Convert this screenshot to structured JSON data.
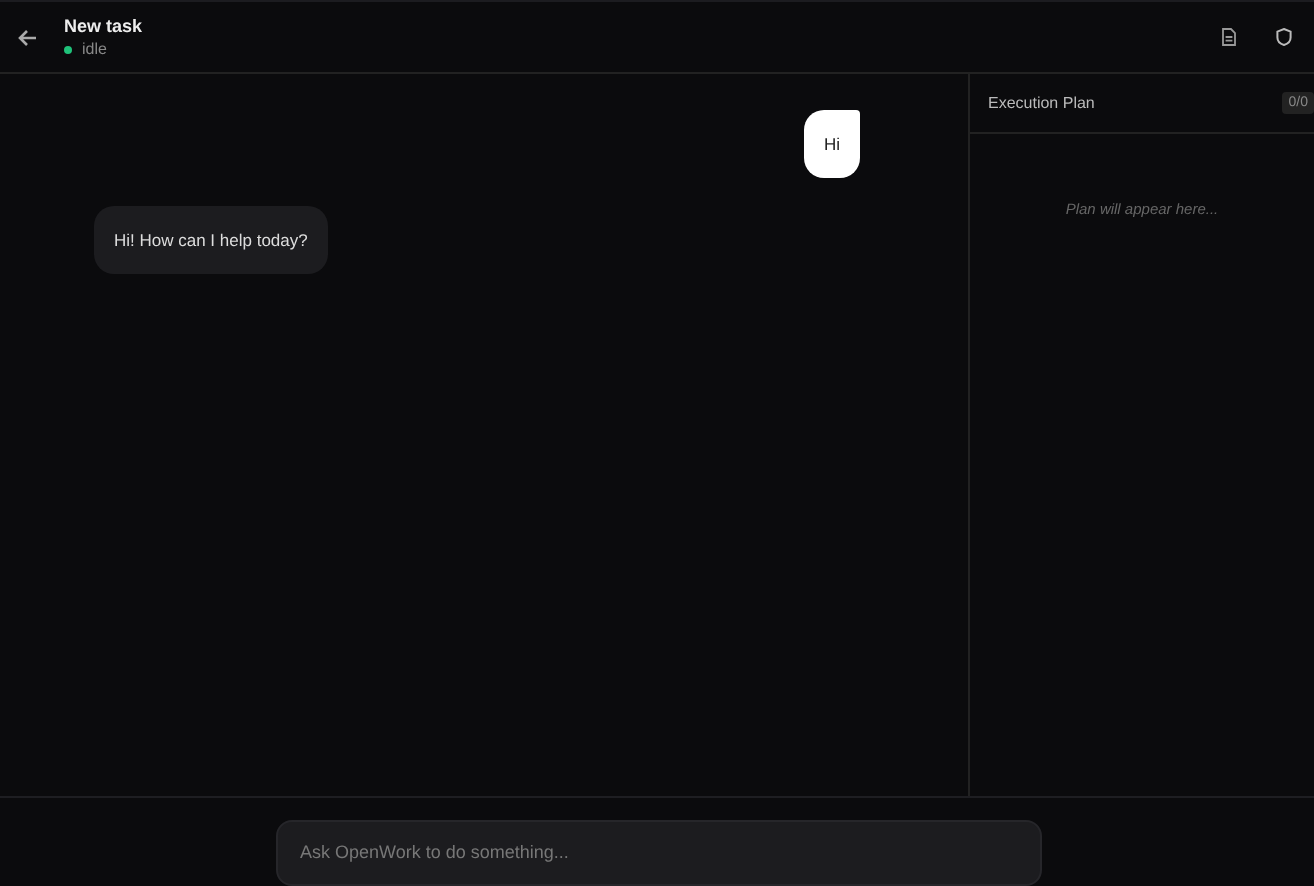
{
  "header": {
    "title": "New task",
    "status": "idle"
  },
  "messages": [
    {
      "kind": "user",
      "text": "Hi"
    },
    {
      "kind": "assistant",
      "text": "Hi! How can I help today?"
    }
  ],
  "plan": {
    "title": "Execution Plan",
    "count": "0/0",
    "placeholder": "Plan will appear here..."
  },
  "composer": {
    "placeholder": "Ask OpenWork to do something..."
  }
}
